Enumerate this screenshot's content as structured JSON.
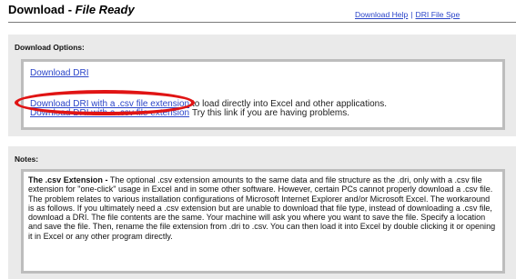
{
  "header": {
    "title_prefix": "Download - ",
    "title_emphasis": "File Ready",
    "help_link": "Download Help",
    "separator": "|",
    "spec_link": "DRI File Spe"
  },
  "options": {
    "heading": "Download Options:",
    "download_dri": "Download DRI",
    "download_csv": "Download DRI with a .csv file extension",
    "download_csv_desc": "to load directly into Excel and other applications.",
    "download_csv_alt": "Download DRI with a .csv file extension",
    "download_csv_alt_desc": "Try this link if you are having problems."
  },
  "notes": {
    "heading": "Notes:",
    "lead": "The .csv Extension -",
    "body": "The optional .csv extension amounts to the same data and file structure as the .dri, only with a .csv file extension for \"one-click\" usage in Excel and in some other software. However, certain PCs cannot properly download a .csv file. The problem relates to various installation configurations of Microsoft Internet Explorer and/or Microsoft Excel. The workaround is as follows. If you ultimately need a .csv extension but are unable to download that file type, instead of downloading a .csv file, download a DRI. The file contents are the same. Your machine will ask you where you want to save the file. Specify a location and save the file. Then, rename the file extension from .dri to .csv. You can then load it into Excel by double clicking it or opening it in Excel or any other program directly."
  },
  "colors": {
    "link": "#2b45c9",
    "panel_bg": "#eaeaea",
    "inner_border": "#bdbdbd",
    "highlight": "#e01414"
  }
}
